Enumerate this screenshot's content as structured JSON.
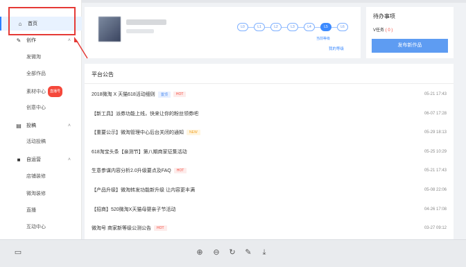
{
  "sidebar": {
    "home": "首页",
    "create": "创作",
    "create_items": [
      "发微淘",
      "全部作品"
    ],
    "material": "素材中心",
    "material_badge": "直播号",
    "creative": "创意中心",
    "submit": "投稿",
    "submit_items": [
      "活动投稿"
    ],
    "operate": "自运营",
    "operate_items": [
      "店铺装修",
      "微淘装修",
      "直播",
      "互动中心"
    ]
  },
  "profile": {
    "levels": [
      "L0",
      "L1",
      "L2",
      "L3",
      "L4",
      "L5",
      "L6"
    ],
    "current_level": "L5",
    "level_label": "当前等级",
    "my_level_link": "我的等级"
  },
  "todo": {
    "title": "待办事项",
    "task_label": "V任务",
    "task_count": "( 0 )",
    "publish_button": "发布新作品"
  },
  "announcements": {
    "title": "平台公告",
    "items": [
      {
        "text": "2018微淘 X 天猫618活动细则",
        "tags": [
          {
            "label": "置顶",
            "kind": "blue"
          },
          {
            "label": "HOT",
            "kind": "hot"
          }
        ],
        "date": "05-21 17:43"
      },
      {
        "text": "【新工具】派券功能上线，快来让你的粉丝领券吧",
        "tags": [],
        "date": "06-07 17:28"
      },
      {
        "text": "【重要公示】微淘管理中心后台关闭的通知",
        "tags": [
          {
            "label": "NEW",
            "kind": "new"
          }
        ],
        "date": "05-29 18:13"
      },
      {
        "text": "618淘宝头条【亲测节】第八期商家征集活动",
        "tags": [],
        "date": "05-25 10:29"
      },
      {
        "text": "生意参谋内容分析2.0升级要点及FAQ",
        "tags": [
          {
            "label": "HOT",
            "kind": "hot"
          }
        ],
        "date": "05-21 17:43"
      },
      {
        "text": "【产品升级】微淘转发功能新升级 让内容更丰满",
        "tags": [],
        "date": "05-08 22:06"
      },
      {
        "text": "【招商】520微淘X天猫母婴亲子节活动",
        "tags": [],
        "date": "04-26 17:08"
      },
      {
        "text": "微淘号 商家新等级公测公告",
        "tags": [
          {
            "label": "HOT",
            "kind": "hot"
          }
        ],
        "date": "03-27 09:12"
      }
    ]
  },
  "toolbar": {
    "icons": [
      "panel-icon",
      "zoom-in-icon",
      "zoom-out-icon",
      "rotate-icon",
      "edit-icon",
      "download-icon"
    ]
  }
}
